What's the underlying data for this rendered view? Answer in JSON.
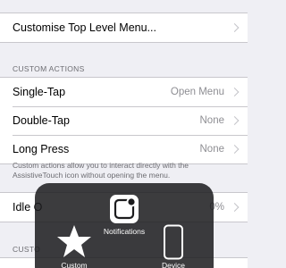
{
  "top_group": {
    "customise_label": "Customise Top Level Menu..."
  },
  "custom_actions": {
    "header": "CUSTOM ACTIONS",
    "rows": [
      {
        "label": "Single-Tap",
        "value": "Open Menu"
      },
      {
        "label": "Double-Tap",
        "value": "None"
      },
      {
        "label": "Long Press",
        "value": "None"
      }
    ],
    "footer": "Custom actions allow you to interact directly with the AssistiveTouch icon without opening the menu."
  },
  "idle_group": {
    "label": "Idle O",
    "value": "0%"
  },
  "custom_section": {
    "header": "CUSTO"
  },
  "assistive_menu": {
    "notifications_label": "Notifications",
    "custom_label": "Custom",
    "device_label": "Device"
  },
  "colors": {
    "background": "#efeff4",
    "secondary_text": "#8e8e93",
    "header_text": "#6d6d72",
    "overlay": "#1c1c1e"
  },
  "icons": [
    "chevron-right-icon",
    "notifications-icon",
    "star-icon",
    "device-icon"
  ]
}
